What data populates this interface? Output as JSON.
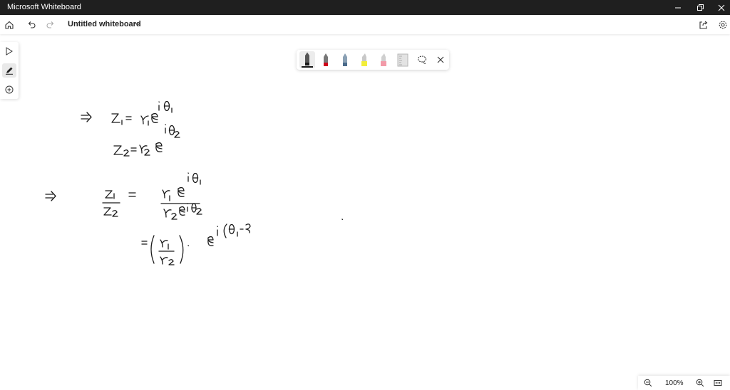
{
  "app": {
    "title": "Microsoft Whiteboard"
  },
  "toolbar": {
    "board_title": "Untitled whiteboard"
  },
  "pen_tray": {
    "pens": [
      {
        "name": "black-pen",
        "color": "#1a1a1a"
      },
      {
        "name": "red-pen",
        "color": "#d0021b"
      },
      {
        "name": "blue-pen",
        "color": "#4a6a8a"
      },
      {
        "name": "yellow-highlighter",
        "color": "#f2ee3a"
      },
      {
        "name": "pink-highlighter",
        "color": "#f29aa8"
      },
      {
        "name": "ruler",
        "color": "#b5b5b5"
      }
    ],
    "selected": "black-pen"
  },
  "zoom": {
    "level": "100%"
  },
  "icons": [
    "home-icon",
    "undo-icon",
    "redo-icon",
    "chevron-down-icon",
    "share-icon",
    "gear-icon",
    "select-arrow-icon",
    "pen-icon",
    "add-icon",
    "lasso-icon",
    "close-icon",
    "zoom-out-icon",
    "zoom-in-icon",
    "fit-to-screen-icon",
    "minimize-icon",
    "restore-icon",
    "close-window-icon"
  ],
  "colors": {
    "titlebar": "#1f1f1f",
    "canvas": "#ffffff",
    "ink": "#1a1a1a"
  }
}
